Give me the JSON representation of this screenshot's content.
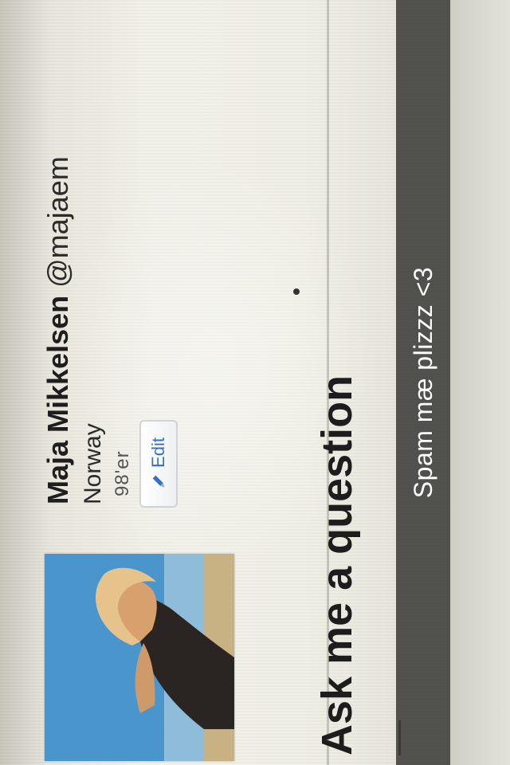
{
  "profile": {
    "name": "Maja Mikkelsen",
    "handle": "@majaem",
    "location": "Norway",
    "bio": "98'er",
    "edit_label": "Edit"
  },
  "ask": {
    "heading": "Ask me a question"
  },
  "caption": {
    "text": "Spam mæ plizzz <3"
  },
  "icons": {
    "edit": "pencil-icon"
  },
  "colors": {
    "edit_text": "#3a6fb8",
    "caption_bar": "#3c3c3a",
    "avatar_sky": "#3f8ec9"
  }
}
